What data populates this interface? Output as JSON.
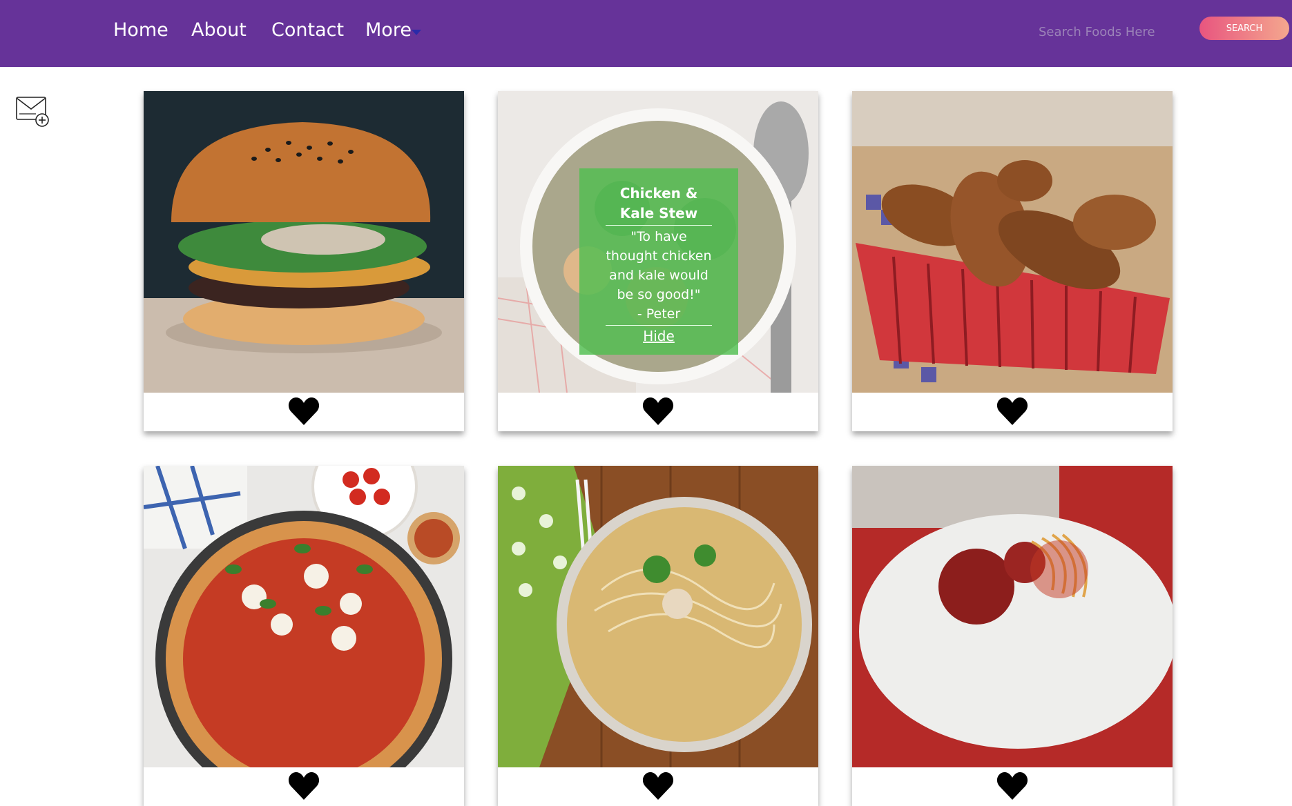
{
  "nav": {
    "items": [
      {
        "label": "Home"
      },
      {
        "label": "About"
      },
      {
        "label": "Contact"
      },
      {
        "label": "More"
      }
    ]
  },
  "search": {
    "placeholder": "Search Foods Here",
    "button_label": "SEARCH"
  },
  "colors": {
    "nav_bar": "#663399",
    "search_button_gradient": [
      "#e8557f",
      "#f4a78e"
    ],
    "overlay": "#50be50"
  },
  "cards": [
    {
      "image": "burger"
    },
    {
      "image": "chicken-kale-stew",
      "overlay": {
        "title": "Chicken & Kale Stew",
        "quote": "\"To have thought chicken and kale would be so good!\"",
        "author": "- Peter",
        "hide_label": "Hide"
      }
    },
    {
      "image": "fried-jalapeno-poppers"
    },
    {
      "image": "pizza"
    },
    {
      "image": "noodle-bowl"
    },
    {
      "image": "spaghetti-meatballs"
    }
  ],
  "icons": {
    "mail": "envelope-plus-icon",
    "like": "heart-icon"
  }
}
